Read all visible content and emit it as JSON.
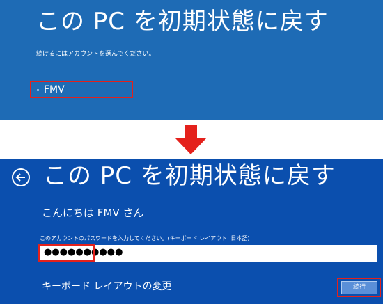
{
  "top_screen": {
    "title": "この PC を初期状態に戻す",
    "instruction": "続けるにはアカウントを選んでください。",
    "account_name": "FMV"
  },
  "bottom_screen": {
    "title": "この PC を初期状態に戻す",
    "greeting": "こんにちは FMV さん",
    "password_label": "このアカウントのパスワードを入力してください。(キーボード レイアウト: 日本語)",
    "password_value": "●●●●●●●●●●",
    "keyboard_layout_link": "キーボード レイアウトの変更",
    "continue_label": "続行"
  },
  "colors": {
    "top_background": "#1e6bb5",
    "bottom_background": "#0b4fae",
    "highlight": "#e4211c",
    "arrow": "#e4211c"
  },
  "icons": {
    "back": "back-arrow-icon",
    "transition": "down-arrow-icon"
  }
}
